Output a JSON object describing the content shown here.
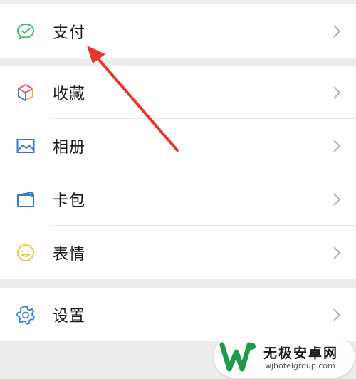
{
  "menu": {
    "groups": [
      {
        "items": [
          {
            "label": "支付",
            "icon": "pay-icon"
          }
        ]
      },
      {
        "items": [
          {
            "label": "收藏",
            "icon": "favorites-icon"
          },
          {
            "label": "相册",
            "icon": "album-icon"
          },
          {
            "label": "卡包",
            "icon": "card-wallet-icon"
          },
          {
            "label": "表情",
            "icon": "sticker-smile-icon"
          }
        ]
      },
      {
        "items": [
          {
            "label": "设置",
            "icon": "settings-gear-icon"
          }
        ]
      }
    ]
  },
  "watermark": {
    "title": "无极安卓网",
    "url": "wjhotelgroup.com"
  },
  "colors": {
    "background": "#ededed",
    "row": "#ffffff",
    "annotation_arrow": "#e8362c",
    "pay_icon": "#3fb86a",
    "album_icon": "#3a78c8",
    "card_icon": "#2f80c9",
    "sticker_icon": "#f0c33a",
    "settings_icon": "#2d7fd0"
  }
}
